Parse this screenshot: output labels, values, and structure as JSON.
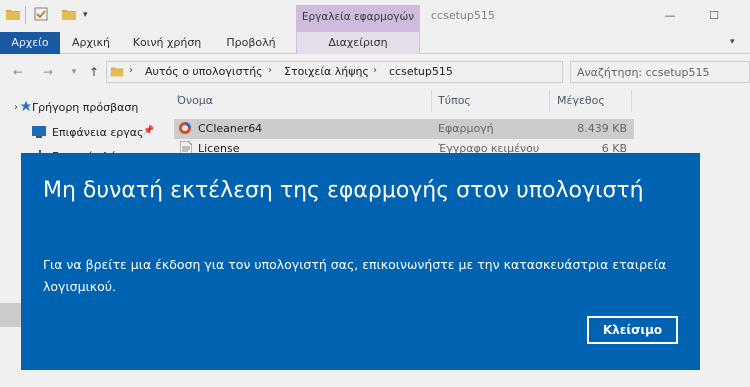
{
  "window": {
    "title": "ccsetup515",
    "contextual_tab_group": "Εργαλεία εφαρμογών",
    "caption_minimize": "—",
    "caption_maximize": "☐"
  },
  "ribbon": {
    "tabs": [
      {
        "label": "Αρχείο"
      },
      {
        "label": "Αρχική"
      },
      {
        "label": "Κοινή χρήση"
      },
      {
        "label": "Προβολή"
      },
      {
        "label": "Διαχείριση"
      }
    ]
  },
  "address_bar": {
    "breadcrumbs": [
      "Αυτός ο υπολογιστής",
      "Στοιχεία λήψης",
      "ccsetup515"
    ],
    "search_placeholder": "Αναζήτηση: ccsetup515"
  },
  "navigation_pane": {
    "items": [
      {
        "label": "Γρήγορη πρόσβαση",
        "icon": "star-icon"
      },
      {
        "label": "Επιφάνεια εργας",
        "icon": "desktop-icon",
        "pinned": true
      },
      {
        "label": "Στοιχεία λήψης",
        "icon": "download-icon"
      }
    ]
  },
  "file_list": {
    "columns": [
      "Όνομα",
      "Τύπος",
      "Μέγεθος"
    ],
    "rows": [
      {
        "name": "CCleaner64",
        "type": "Εφαρμογή",
        "size": "8.439 KB",
        "selected": true,
        "icon": "ccleaner-icon"
      },
      {
        "name": "License",
        "type": "Έγγραφο κειμένου",
        "size": "6 KB",
        "selected": false,
        "icon": "text-file-icon"
      }
    ]
  },
  "dialog": {
    "title": "Μη δυνατή εκτέλεση της εφαρμογής στον υπολογιστή",
    "message": "Για να βρείτε μια έκδοση για τον υπολογιστή σας, επικοινωνήστε με την κατασκευάστρια εταιρεία λογισμικού.",
    "close_button": "Κλείσιμο",
    "background_color": "#0063b1"
  }
}
